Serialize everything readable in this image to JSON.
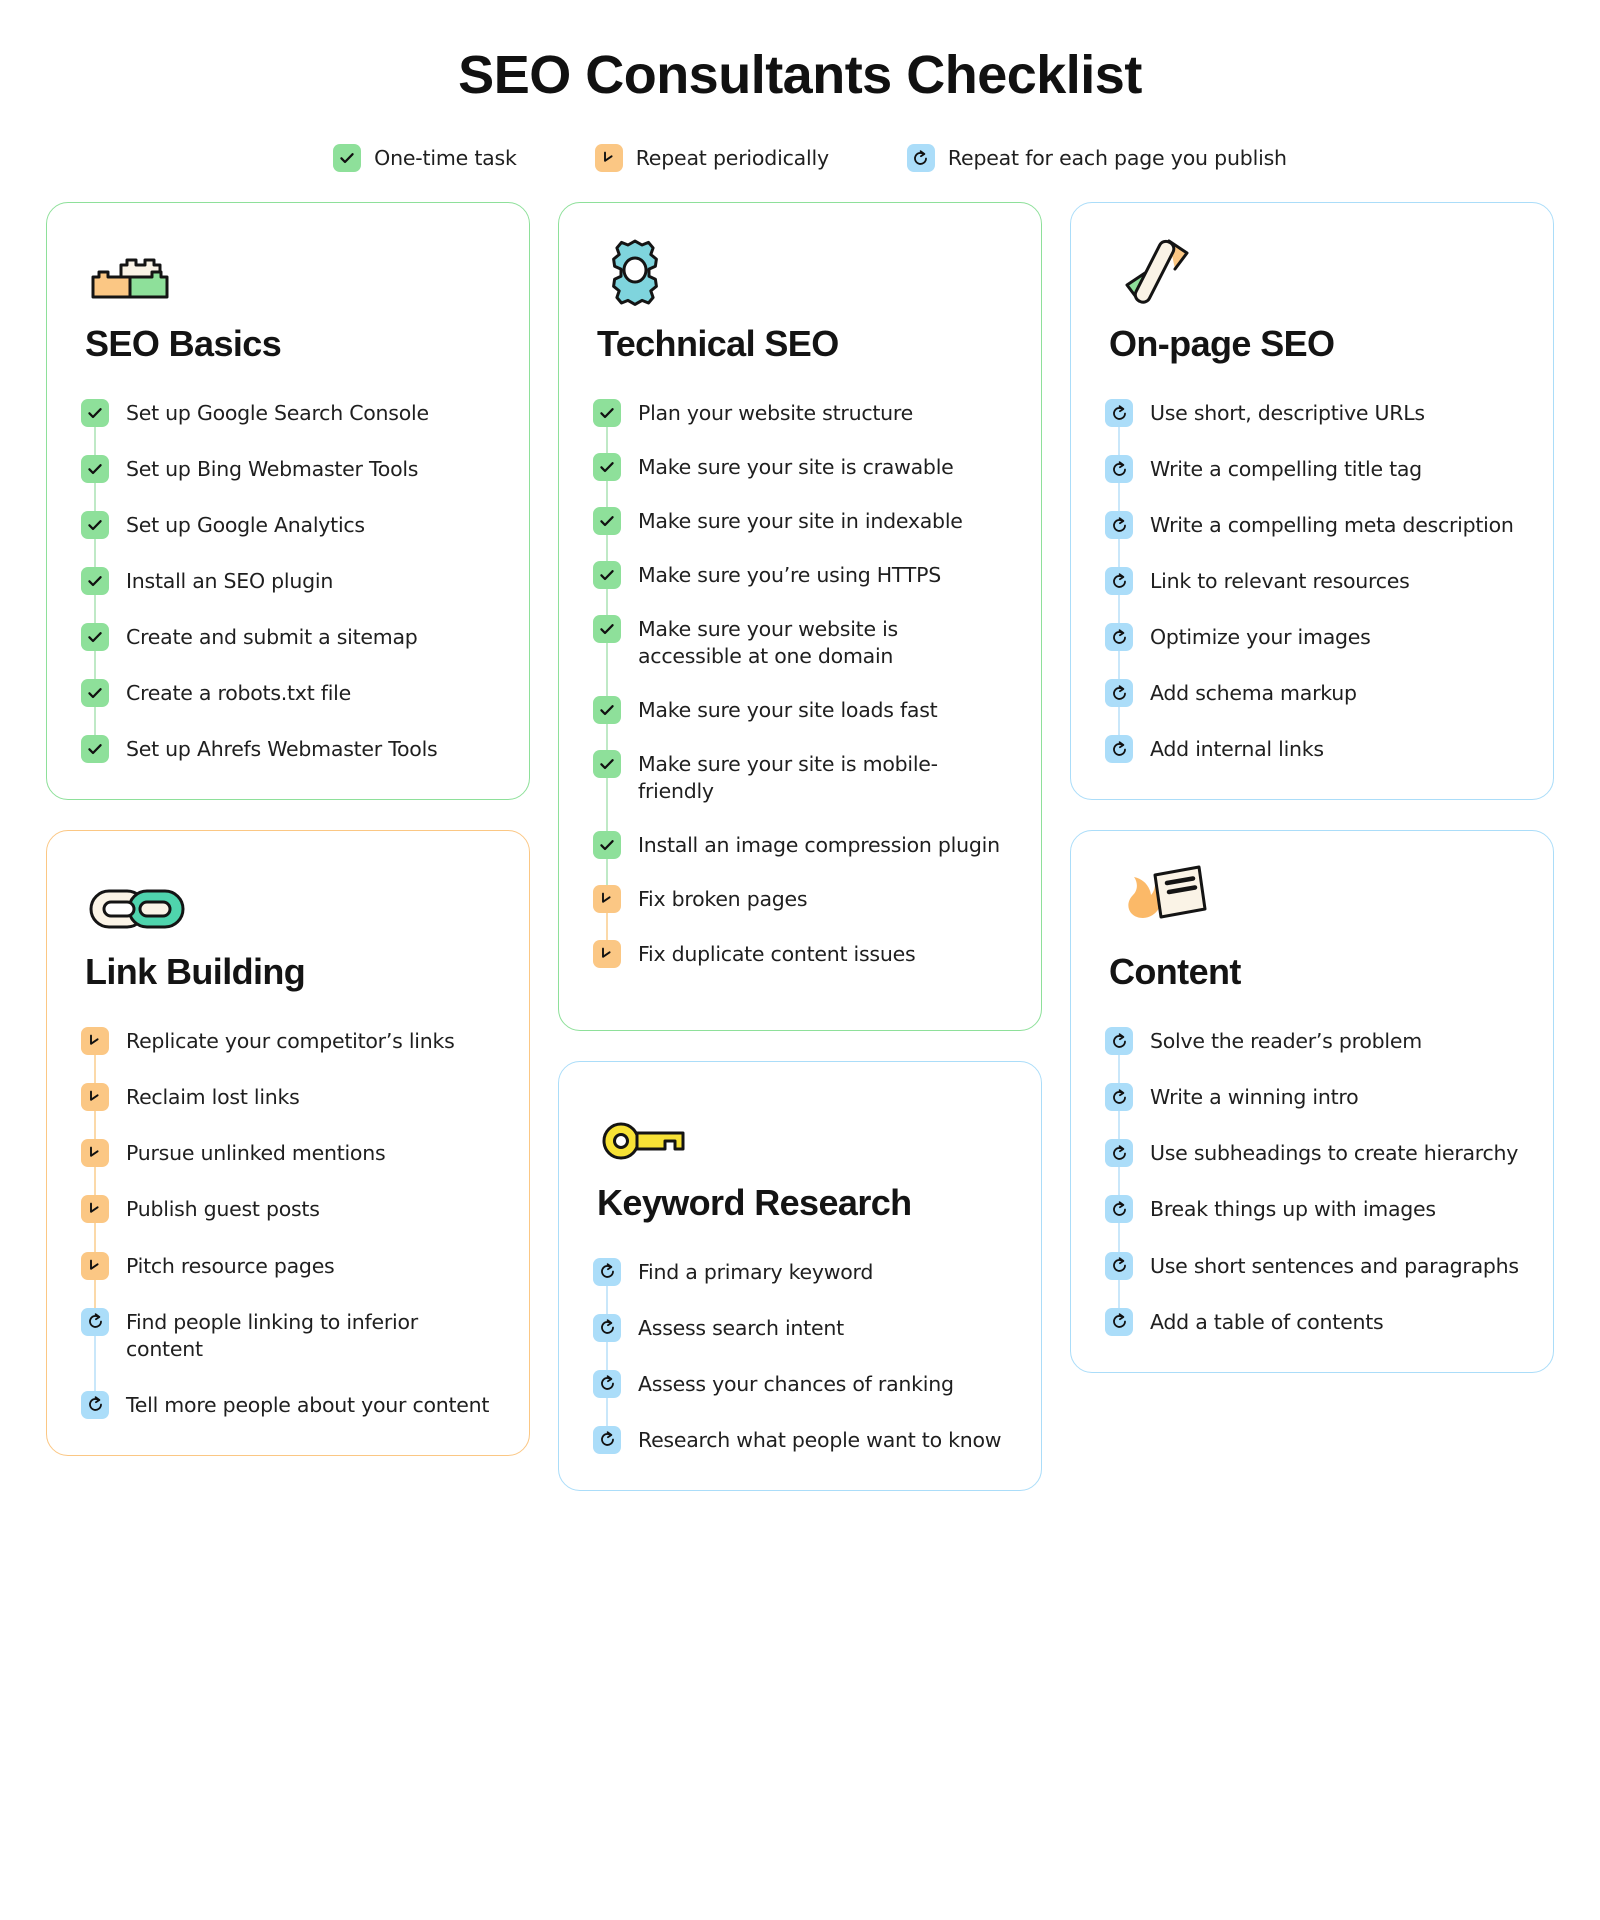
{
  "header": {
    "title": "SEO Consultants Checklist"
  },
  "legend": {
    "items": [
      {
        "label": "One-time task",
        "icon": "check-icon",
        "color": "#8ee09a",
        "type": "green"
      },
      {
        "label": "Repeat periodically",
        "icon": "clock-arrow-icon",
        "color": "#fbc784",
        "type": "orange"
      },
      {
        "label": "Repeat for each page you publish",
        "icon": "refresh-icon",
        "color": "#abddf9",
        "type": "blue"
      }
    ]
  },
  "cards": {
    "seo_basics": {
      "title": "SEO Basics",
      "icon": "lego-bricks-icon",
      "border_color": "#8ee09a",
      "tasks": [
        {
          "text": "Set up Google Search Console",
          "type": "green"
        },
        {
          "text": "Set up Bing Webmaster Tools",
          "type": "green"
        },
        {
          "text": "Set up Google Analytics",
          "type": "green"
        },
        {
          "text": "Install an SEO plugin",
          "type": "green"
        },
        {
          "text": "Create and submit a sitemap",
          "type": "green"
        },
        {
          "text": "Create a robots.txt file",
          "type": "green"
        },
        {
          "text": "Set up Ahrefs Webmaster Tools",
          "type": "green"
        }
      ]
    },
    "link_building": {
      "title": "Link Building",
      "icon": "chain-link-icon",
      "border_color": "#fbc784",
      "tasks": [
        {
          "text": "Replicate your competitor’s links",
          "type": "orange"
        },
        {
          "text": "Reclaim lost links",
          "type": "orange"
        },
        {
          "text": "Pursue unlinked mentions",
          "type": "orange"
        },
        {
          "text": "Publish guest posts",
          "type": "orange"
        },
        {
          "text": "Pitch resource pages",
          "type": "orange"
        },
        {
          "text": "Find people linking to inferior content",
          "type": "blue"
        },
        {
          "text": "Tell more people about your content",
          "type": "blue"
        }
      ]
    },
    "technical_seo": {
      "title": "Technical SEO",
      "icon": "gear-icon",
      "border_color": "#8ee09a",
      "tasks": [
        {
          "text": "Plan your website structure",
          "type": "green"
        },
        {
          "text": "Make sure your site is crawable",
          "type": "green"
        },
        {
          "text": "Make sure your site in indexable",
          "type": "green"
        },
        {
          "text": "Make sure you’re using HTTPS",
          "type": "green"
        },
        {
          "text": "Make sure your website is accessible at one domain",
          "type": "green"
        },
        {
          "text": "Make sure your site loads fast",
          "type": "green"
        },
        {
          "text": "Make sure your site is mobile-friendly",
          "type": "green"
        },
        {
          "text": "Install an image compression plugin",
          "type": "green"
        },
        {
          "text": "Fix broken pages",
          "type": "orange"
        },
        {
          "text": "Fix duplicate content issues",
          "type": "orange"
        }
      ]
    },
    "keyword_research": {
      "title": "Keyword Research",
      "icon": "key-icon",
      "border_color": "#abddf9",
      "tasks": [
        {
          "text": "Find a primary keyword",
          "type": "blue"
        },
        {
          "text": "Assess search intent",
          "type": "blue"
        },
        {
          "text": "Assess your chances of ranking",
          "type": "blue"
        },
        {
          "text": "Research what people want to know",
          "type": "blue"
        }
      ]
    },
    "onpage_seo": {
      "title": "On-page SEO",
      "icon": "code-brackets-icon",
      "border_color": "#abddf9",
      "tasks": [
        {
          "text": "Use short, descriptive URLs",
          "type": "blue"
        },
        {
          "text": "Write a compelling title tag",
          "type": "blue"
        },
        {
          "text": "Write a compelling meta description",
          "type": "blue"
        },
        {
          "text": "Link to relevant resources",
          "type": "blue"
        },
        {
          "text": "Optimize your images",
          "type": "blue"
        },
        {
          "text": "Add schema markup",
          "type": "blue"
        },
        {
          "text": "Add internal links",
          "type": "blue"
        }
      ]
    },
    "content": {
      "title": "Content",
      "icon": "document-flame-icon",
      "border_color": "#abddf9",
      "tasks": [
        {
          "text": "Solve the reader’s problem",
          "type": "blue"
        },
        {
          "text": "Write a winning intro",
          "type": "blue"
        },
        {
          "text": "Use subheadings to create hierarchy",
          "type": "blue"
        },
        {
          "text": "Break things up with images",
          "type": "blue"
        },
        {
          "text": "Use short sentences and paragraphs",
          "type": "blue"
        },
        {
          "text": "Add a table of contents",
          "type": "blue"
        }
      ]
    }
  },
  "colors": {
    "green": "#8ee09a",
    "orange": "#fbc784",
    "blue": "#abddf9",
    "mint": "#4fd4ad",
    "cream": "#faf3e6",
    "teal": "#7fd4dd",
    "text": "#1f1f1f"
  }
}
